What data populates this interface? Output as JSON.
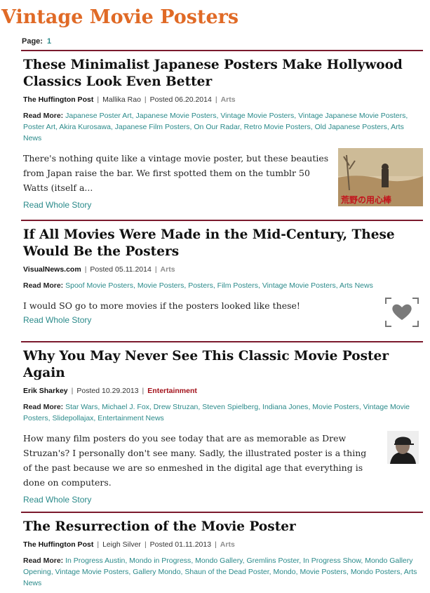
{
  "site": {
    "title": "Vintage Movie Posters"
  },
  "pager": {
    "label": "Page:",
    "current": "1"
  },
  "read_more_label": "Read More:",
  "read_whole_story": "Read Whole Story",
  "articles": [
    {
      "title": "These Minimalist Japanese Posters Make Hollywood Classics Look Even Better",
      "source": "The Huffington Post",
      "author": "Mallika Rao",
      "posted": "Posted 06.20.2014",
      "category": "Arts",
      "tags": [
        "Japanese Poster Art",
        "Japanese Movie Posters",
        "Vintage Movie Posters",
        "Vintage Japanese Movie Posters",
        "Poster Art",
        "Akira Kurosawa",
        "Japanese Film Posters",
        "On Our Radar",
        "Retro Movie Posters",
        "Old Japanese Posters",
        "Arts News"
      ],
      "excerpt": "There's nothing quite like a vintage movie poster, but these beauties from Japan raise the bar. We first spotted them on the tumblr 50 Watts (itself a...",
      "thumb_text": "荒野の用心棒"
    },
    {
      "title": "If All Movies Were Made in the Mid-Century, These Would Be the Posters",
      "source": "VisualNews.com",
      "author": "",
      "posted": "Posted 05.11.2014",
      "category": "Arts",
      "tags": [
        "Spoof Movie Posters",
        "Movie Posters",
        "Posters",
        "Film Posters",
        "Vintage Movie Posters",
        "Arts News"
      ],
      "excerpt": "I would SO go to more movies if the posters looked like these!"
    },
    {
      "title": "Why You May Never See This Classic Movie Poster Again",
      "source": "Erik Sharkey",
      "author": "",
      "posted": "Posted 10.29.2013",
      "category": "Entertainment",
      "tags": [
        "Star Wars",
        "Michael J. Fox",
        "Drew Struzan",
        "Steven Spielberg",
        "Indiana Jones",
        "Movie Posters",
        "Vintage Movie Posters",
        "Slidepollajax",
        "Entertainment News"
      ],
      "excerpt": "How many film posters do you see today that are as memorable as Drew Struzan's? I personally don't see many. Sadly, the illustrated poster is a thing of the past because we are so enmeshed in the digital age that everything is done on computers."
    },
    {
      "title": "The Resurrection of the Movie Poster",
      "source": "The Huffington Post",
      "author": "Leigh Silver",
      "posted": "Posted 01.11.2013",
      "category": "Arts",
      "tags": [
        "In Progress Austin",
        "Mondo in Progress",
        "Mondo Gallery",
        "Gremlins Poster",
        "In Progress Show",
        "Mondo Gallery Opening",
        "Vintage Movie Posters",
        "Gallery Mondo",
        "Shaun of the Dead Poster",
        "Mondo",
        "Movie Posters",
        "Mondo Posters",
        "Arts News"
      ]
    }
  ]
}
